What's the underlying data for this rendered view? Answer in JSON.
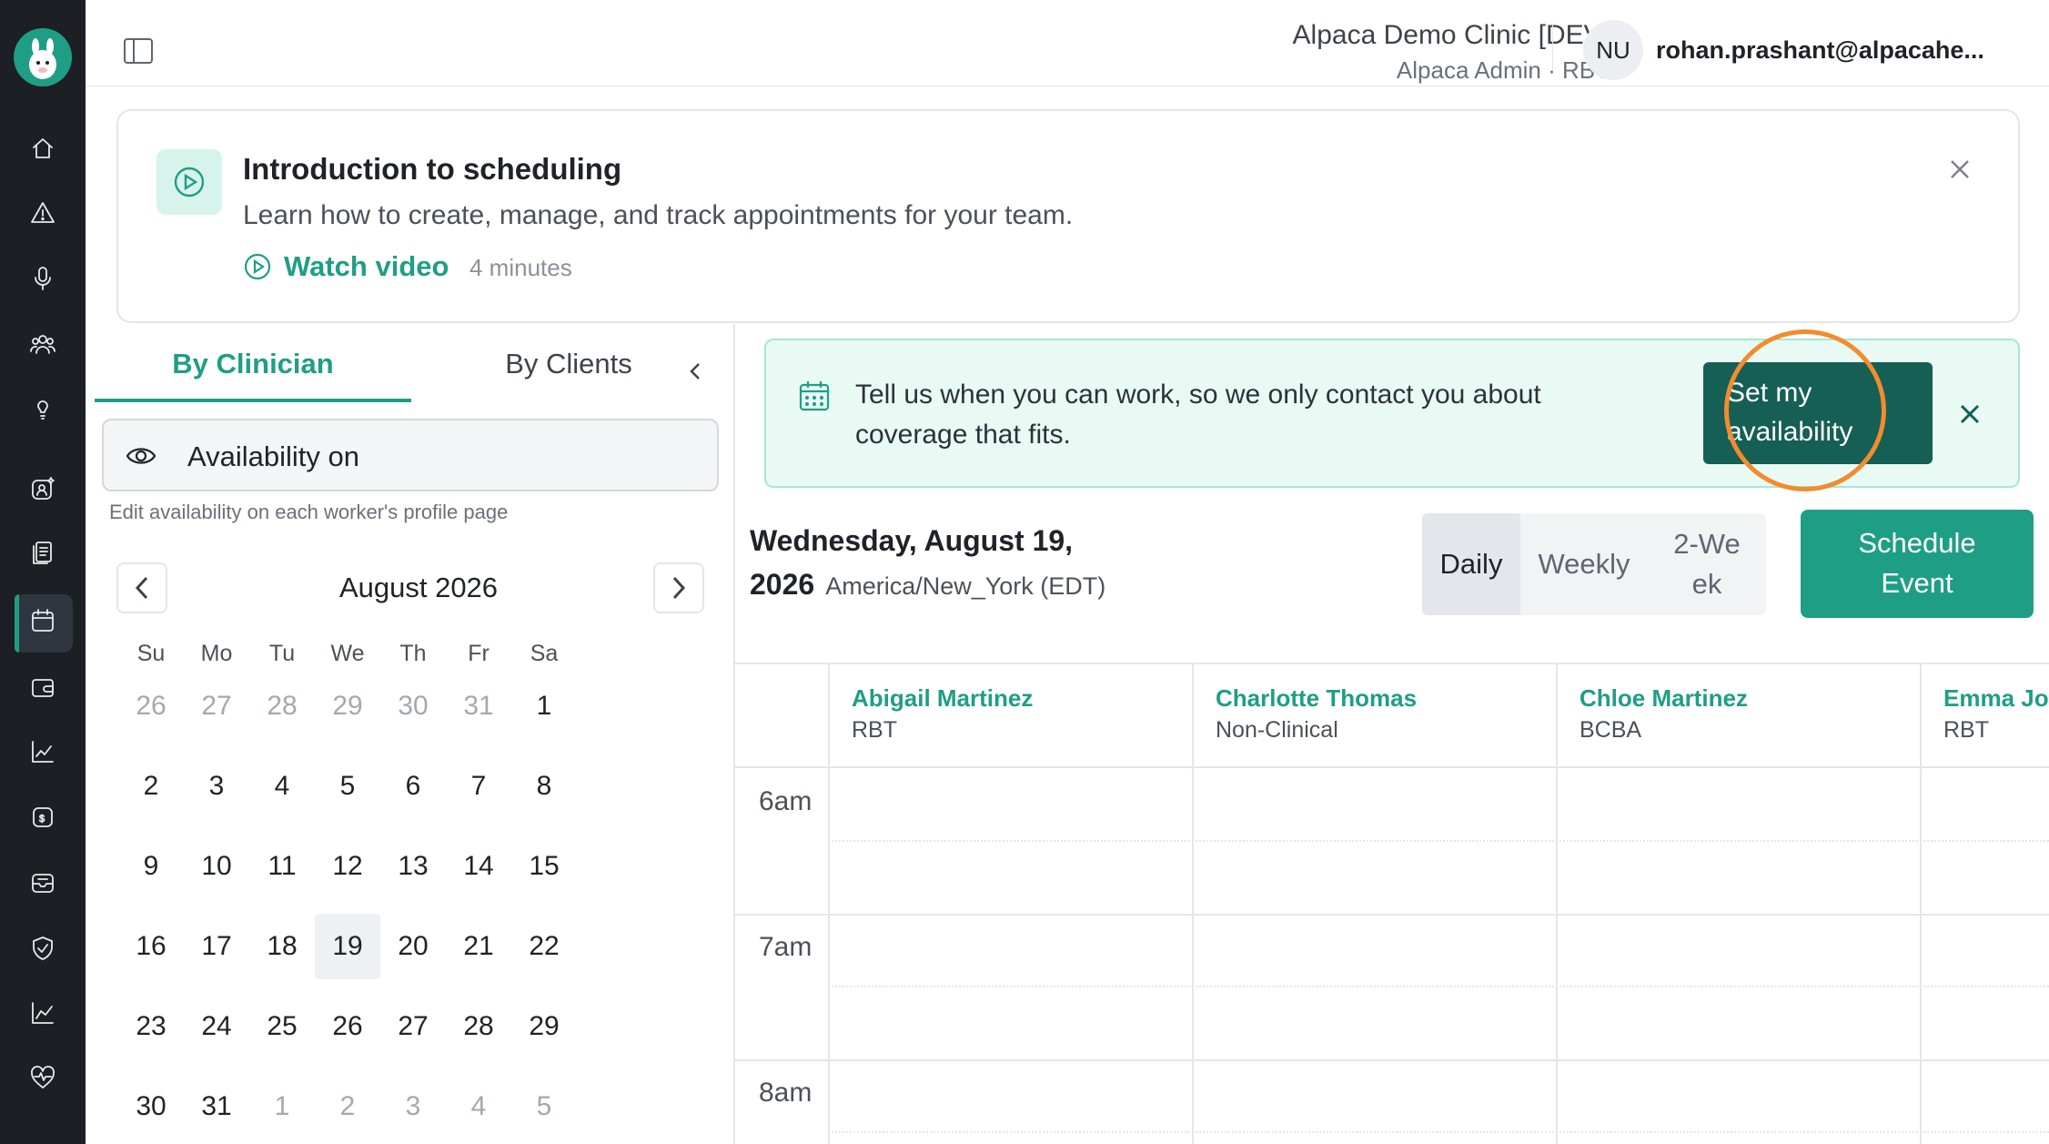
{
  "header": {
    "clinic_name": "Alpaca Demo Clinic [DEV]",
    "clinic_role": "Alpaca Admin · RBT",
    "avatar_initials": "NU",
    "user_email": "rohan.prashant@alpacahe..."
  },
  "sidebar": {
    "items": [
      {
        "icon": "home-icon"
      },
      {
        "icon": "alert-icon"
      },
      {
        "icon": "microphone-icon"
      },
      {
        "icon": "users-icon"
      },
      {
        "icon": "lightbulb-icon"
      },
      {
        "icon": "assistant-icon"
      },
      {
        "icon": "documents-icon"
      },
      {
        "icon": "calendar-icon",
        "active": true
      },
      {
        "icon": "wallet-icon"
      },
      {
        "icon": "chart-icon"
      },
      {
        "icon": "billing-icon"
      },
      {
        "icon": "inbox-icon"
      },
      {
        "icon": "shield-icon"
      },
      {
        "icon": "analytics-icon"
      },
      {
        "icon": "heart-icon"
      }
    ]
  },
  "intro": {
    "title": "Introduction to scheduling",
    "subtitle": "Learn how to create, manage, and track appointments for your team.",
    "watch_label": "Watch video",
    "duration": "4 minutes"
  },
  "left_panel": {
    "tabs": [
      "By Clinician",
      "By Clients"
    ],
    "availability_toggle": "Availability on",
    "availability_help": "Edit availability on each worker's profile page",
    "calendar": {
      "month": "August 2026",
      "weekdays": [
        "Su",
        "Mo",
        "Tu",
        "We",
        "Th",
        "Fr",
        "Sa"
      ],
      "days": [
        {
          "d": "26",
          "m": true
        },
        {
          "d": "27",
          "m": true
        },
        {
          "d": "28",
          "m": true
        },
        {
          "d": "29",
          "m": true
        },
        {
          "d": "30",
          "m": true
        },
        {
          "d": "31",
          "m": true
        },
        {
          "d": "1"
        },
        {
          "d": "2"
        },
        {
          "d": "3"
        },
        {
          "d": "4"
        },
        {
          "d": "5"
        },
        {
          "d": "6"
        },
        {
          "d": "7"
        },
        {
          "d": "8"
        },
        {
          "d": "9"
        },
        {
          "d": "10"
        },
        {
          "d": "11"
        },
        {
          "d": "12"
        },
        {
          "d": "13"
        },
        {
          "d": "14"
        },
        {
          "d": "15"
        },
        {
          "d": "16"
        },
        {
          "d": "17"
        },
        {
          "d": "18"
        },
        {
          "d": "19",
          "selected": true
        },
        {
          "d": "20"
        },
        {
          "d": "21"
        },
        {
          "d": "22"
        },
        {
          "d": "23"
        },
        {
          "d": "24"
        },
        {
          "d": "25"
        },
        {
          "d": "26"
        },
        {
          "d": "27"
        },
        {
          "d": "28"
        },
        {
          "d": "29"
        },
        {
          "d": "30"
        },
        {
          "d": "31"
        },
        {
          "d": "1",
          "m": true
        },
        {
          "d": "2",
          "m": true
        },
        {
          "d": "3",
          "m": true
        },
        {
          "d": "4",
          "m": true
        },
        {
          "d": "5",
          "m": true
        }
      ]
    }
  },
  "banner": {
    "text": "Tell us when you can work, so we only contact you about coverage that fits.",
    "button_label": "Set my availability"
  },
  "main": {
    "date_line1": "Wednesday, August 19,",
    "date_line2": "2026",
    "timezone": "America/New_York (EDT)",
    "views": [
      "Daily",
      "Weekly",
      "2-Week"
    ],
    "active_view": "Daily",
    "schedule_button": "Schedule Event"
  },
  "schedule": {
    "clinicians": [
      {
        "name": "Abigail Martinez",
        "role": "RBT"
      },
      {
        "name": "Charlotte Thomas",
        "role": "Non-Clinical"
      },
      {
        "name": "Chloe Martinez",
        "role": "BCBA"
      },
      {
        "name": "Emma Jo",
        "role": "RBT"
      }
    ],
    "hours": [
      "6am",
      "7am",
      "8am"
    ]
  },
  "colors": {
    "accent": "#1f9e86",
    "accent_dark": "#155f55",
    "sidebar": "#1c1f23",
    "highlight": "#f28c2e"
  }
}
